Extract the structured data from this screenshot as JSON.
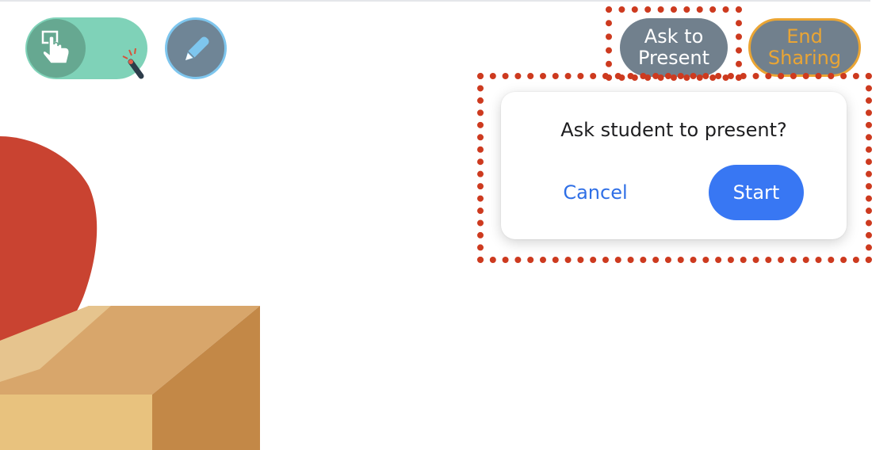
{
  "toolbar": {
    "pointer_tool_icon": "hand-pointer-icon",
    "laser_tool_icon": "laser-wand-icon",
    "pencil_tool_icon": "pencil-icon"
  },
  "buttons": {
    "ask_line1": "Ask to",
    "ask_line2": "Present",
    "end_line1": "End",
    "end_line2": "Sharing"
  },
  "popover": {
    "prompt": "Ask student to present?",
    "cancel_label": "Cancel",
    "start_label": "Start"
  },
  "colors": {
    "accent_blue": "#3877f3",
    "end_sharing_orange": "#eaa534",
    "highlight_red": "#cd3a1f",
    "toggle_green": "#7fd2b8"
  }
}
